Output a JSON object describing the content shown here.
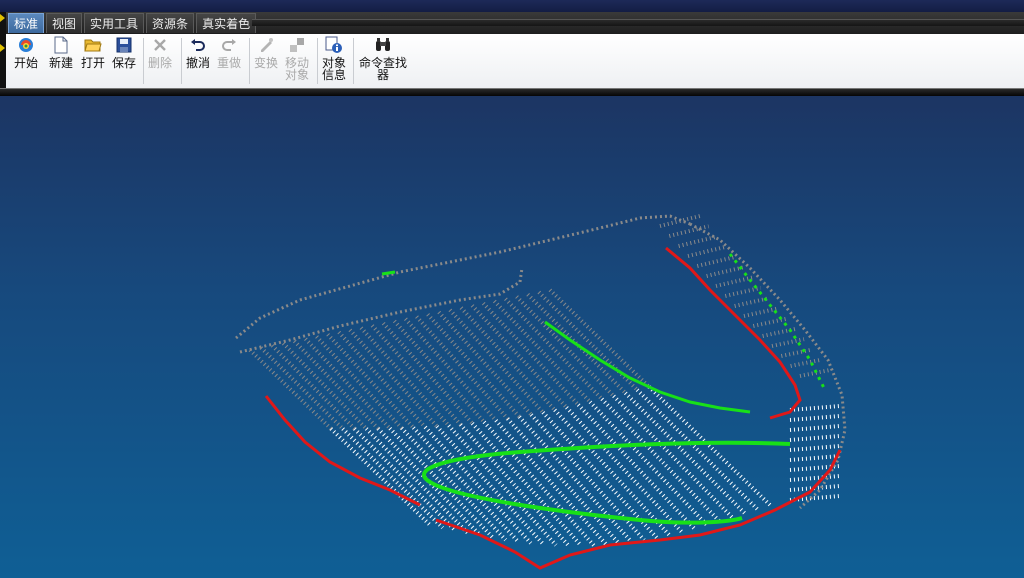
{
  "tabs": [
    {
      "label": "标准",
      "active": true
    },
    {
      "label": "视图",
      "active": false
    },
    {
      "label": "实用工具",
      "active": false
    },
    {
      "label": "资源条",
      "active": false
    },
    {
      "label": "真实着色",
      "active": false
    }
  ],
  "toolbar": {
    "start_label": "开始",
    "new_label": "新建",
    "open_label": "打开",
    "save_label": "保存",
    "delete_label": "删除",
    "undo_label": "撤消",
    "redo_label": "重做",
    "transform_label": "变换",
    "move_object_label": "移动\n对象",
    "object_info_label": "对象\n信息",
    "command_finder_label": "命令查找\n器"
  },
  "colors": {
    "point_white": "#ffffff",
    "point_gray": "#8a8a8a",
    "curve_red": "#e01818",
    "curve_green": "#18e018",
    "tab_active": "#4a7ab0",
    "viewport_top": "#1c3563",
    "viewport_bottom": "#0f5f95"
  },
  "icons": [
    "start-icon",
    "new-file-icon",
    "open-folder-icon",
    "save-disk-icon",
    "delete-x-icon",
    "undo-icon",
    "redo-icon",
    "transform-icon",
    "move-object-icon",
    "object-info-icon",
    "binoculars-icon"
  ]
}
